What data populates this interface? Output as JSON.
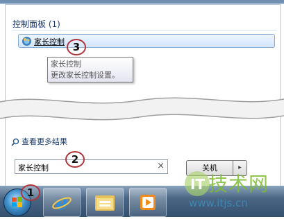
{
  "start_menu": {
    "group_title": "控制面板 (1)",
    "results": [
      {
        "label": "家长控制",
        "icon": "parental-controls-icon"
      }
    ],
    "tooltip": {
      "title": "家长控制",
      "description": "更改家长控制设置。"
    },
    "more_results_label": "查看更多结果",
    "search_value": "家长控制",
    "clear_symbol": "×",
    "shutdown_label": "关机",
    "shutdown_arrow": "▸"
  },
  "markers": [
    "1",
    "2",
    "3"
  ],
  "taskbar": {
    "icons": [
      "start-orb-icon",
      "internet-explorer-icon",
      "windows-explorer-icon",
      "media-player-icon"
    ]
  },
  "watermark": {
    "brand": "技术网",
    "url": "www.itjs.cn"
  },
  "colors": {
    "accent": "#b1343a",
    "taskbar": "#4a6683",
    "highlight": "#d2e5fb",
    "watermark_green": "#7bbd2f",
    "watermark_blue": "#3f8ab5"
  }
}
